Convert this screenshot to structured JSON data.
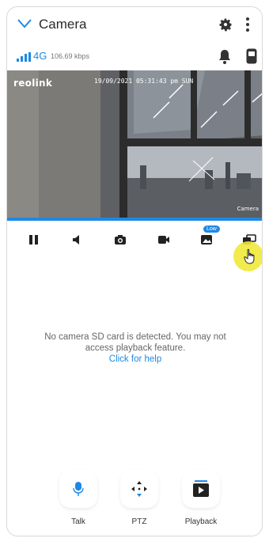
{
  "header": {
    "title": "Camera"
  },
  "status": {
    "network": "4G",
    "bitrate": "106.69 kbps"
  },
  "video": {
    "brand": "reolink",
    "timestamp": "19/09/2021 05:31:43 pm SUN",
    "camera_name": "Camera"
  },
  "toolbar": {
    "quality_badge": "Low"
  },
  "message": {
    "text": "No camera SD card is detected. You may not access playback feature.",
    "help_link": "Click for help"
  },
  "actions": [
    {
      "label": "Talk"
    },
    {
      "label": "PTZ"
    },
    {
      "label": "Playback"
    }
  ],
  "colors": {
    "accent": "#1e88e5",
    "cursor_highlight": "#f0e93a"
  }
}
